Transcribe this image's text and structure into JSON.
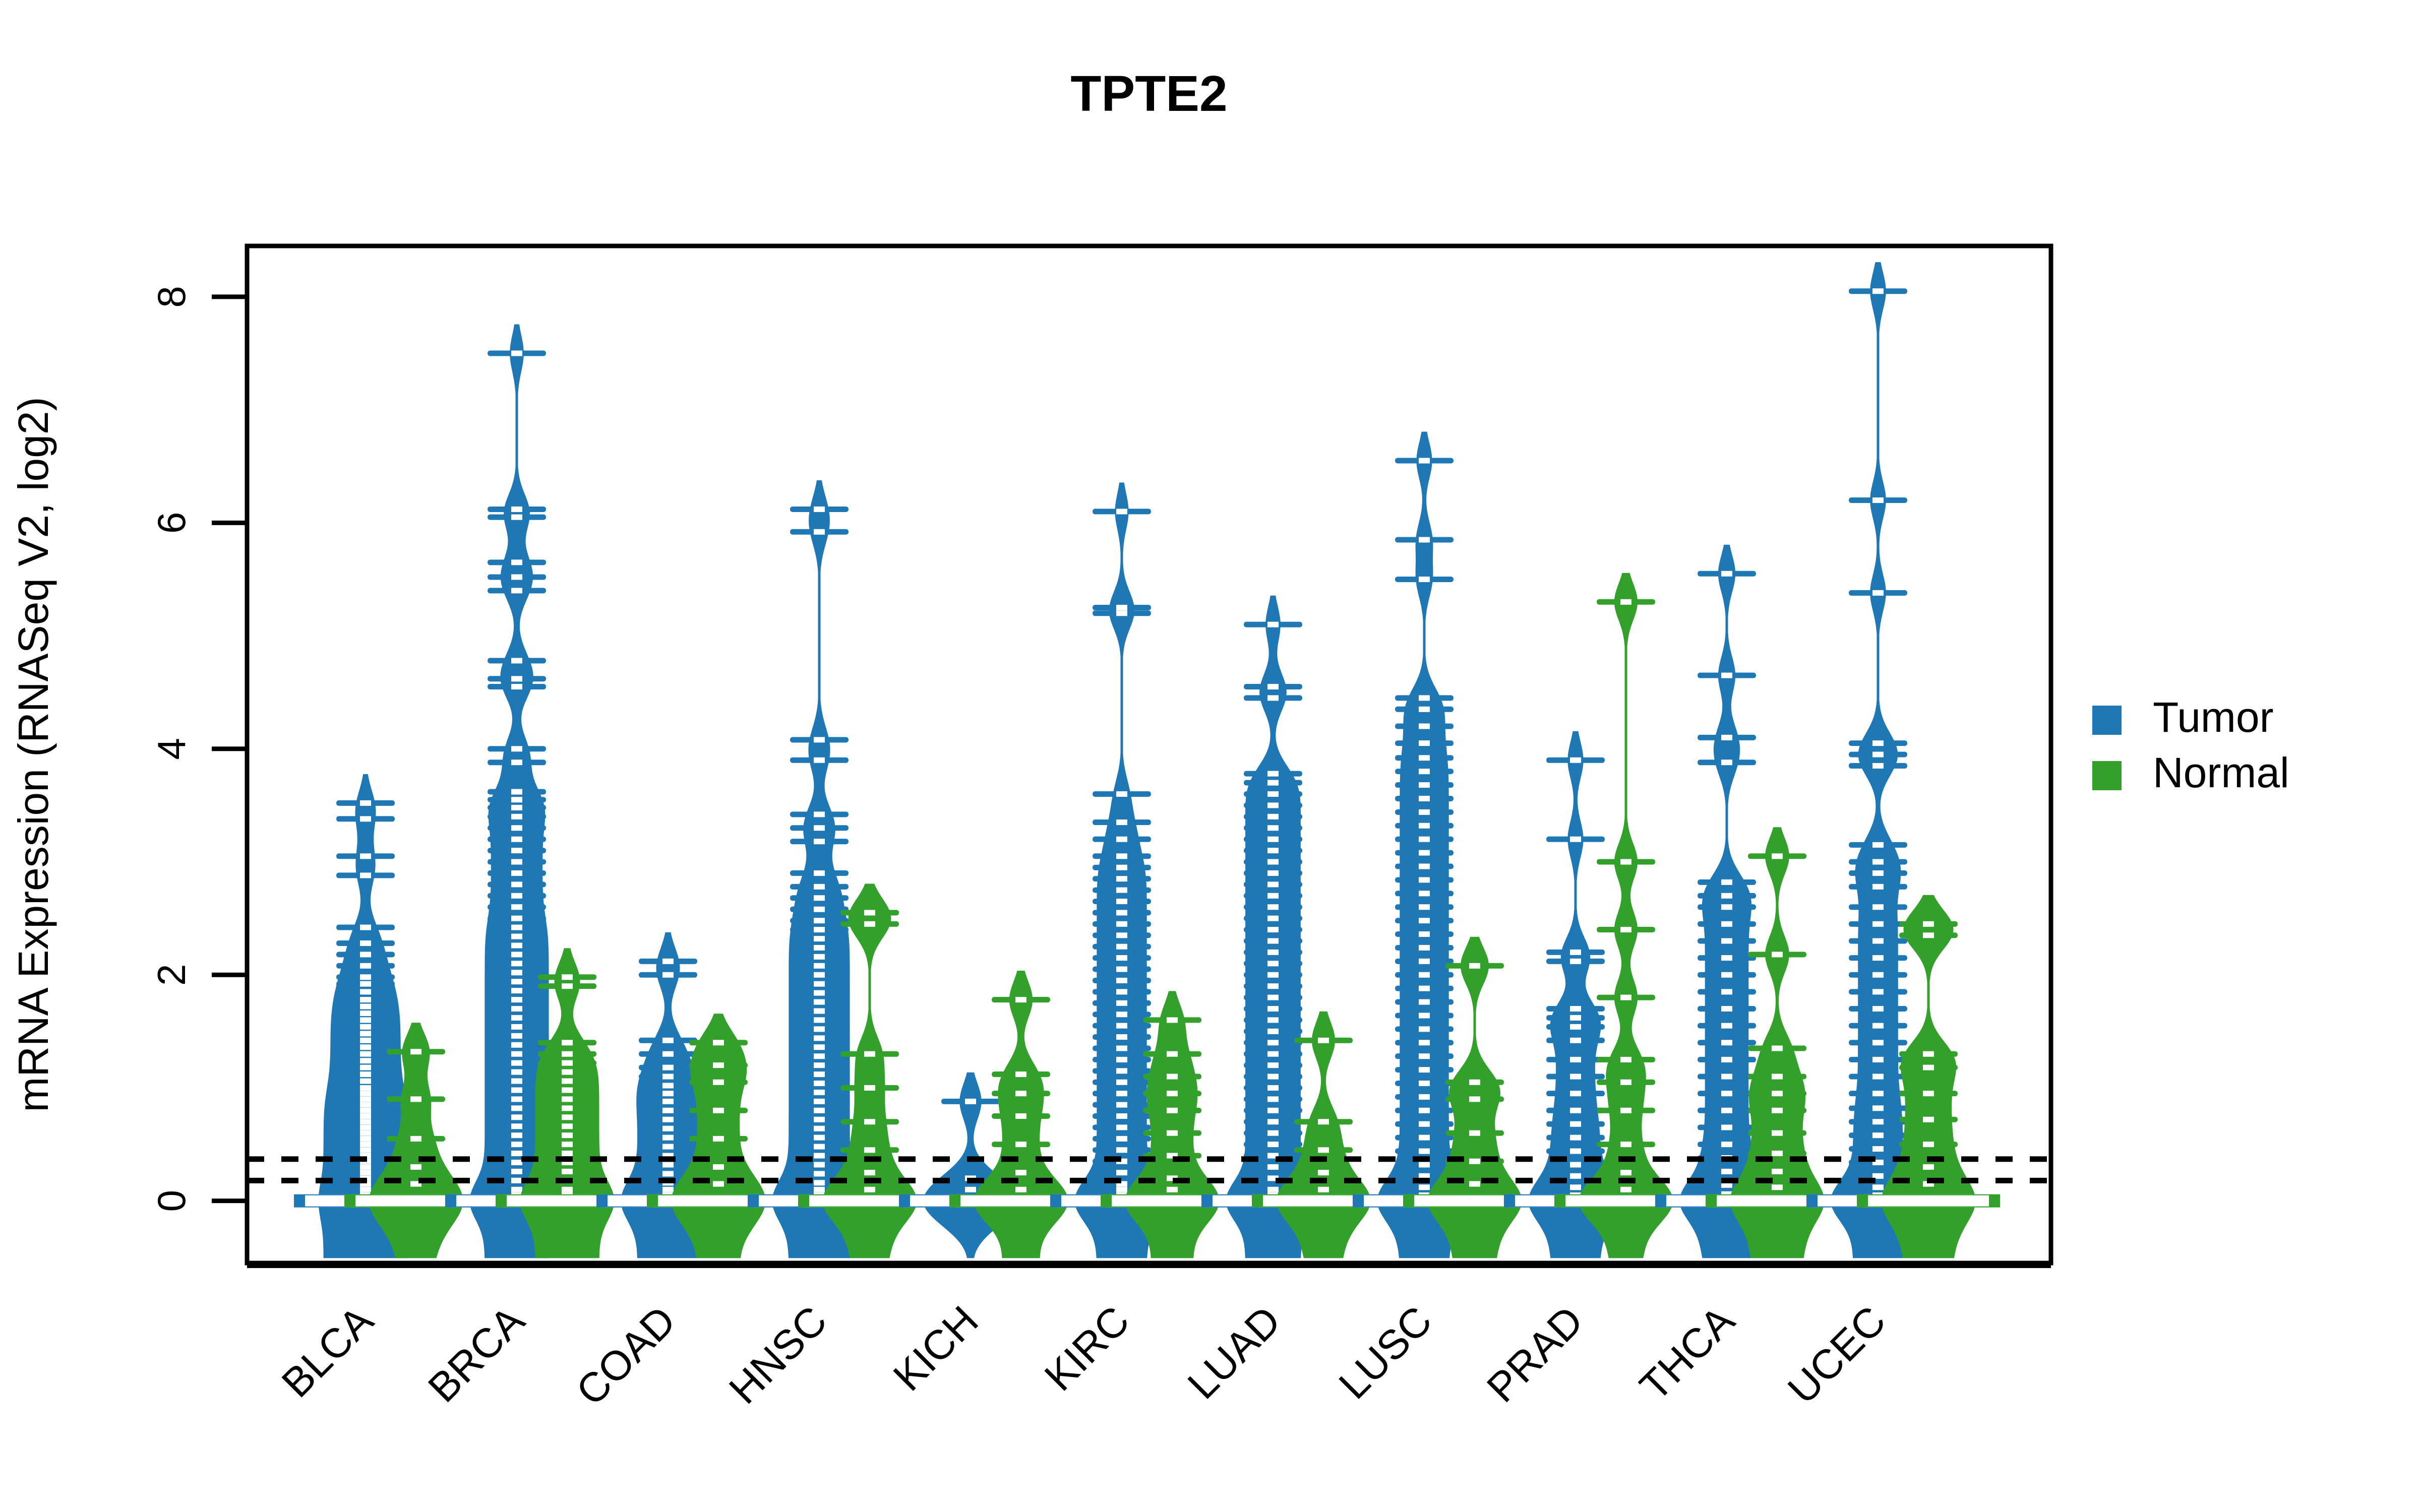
{
  "title": "TPTE2",
  "axes": {
    "ylabel": "mRNA Expression (RNASeq V2, log2)",
    "yticks": [
      "0",
      "2",
      "4",
      "6",
      "8"
    ],
    "ytickvalues": [
      0,
      2,
      4,
      6,
      8
    ],
    "ylim": [
      -0.55,
      8.45
    ],
    "xlabel": ""
  },
  "legend": {
    "position": "right",
    "items": [
      {
        "label": "Tumor",
        "color": "#1f78b4",
        "swatch": "legend-swatch-tumor"
      },
      {
        "label": "Normal",
        "color": "#33a02c",
        "swatch": "legend-swatch-normal"
      }
    ]
  },
  "reference_lines": {
    "values": [
      0.37,
      0.18
    ],
    "style": "dotted",
    "color": "#000000"
  },
  "chart_data": {
    "type": "violin",
    "variant": "beanplot",
    "title": "TPTE2",
    "xlabel": "",
    "ylabel": "mRNA Expression (RNASeq V2, log2)",
    "ylim": [
      -0.55,
      8.45
    ],
    "yticks": [
      0,
      2,
      4,
      6,
      8
    ],
    "grid": false,
    "legend_position": "right",
    "categories": [
      "BLCA",
      "BRCA",
      "COAD",
      "HNSC",
      "KICH",
      "KIRC",
      "LUAD",
      "LUSC",
      "PRAD",
      "THCA",
      "UCEC"
    ],
    "reference_lines": [
      0.37,
      0.18
    ],
    "series": [
      {
        "name": "Tumor",
        "color": "#1f78b4",
        "groups": [
          {
            "category": "BLCA",
            "median": 0.0,
            "max": 3.52,
            "min": 0.0,
            "density_peak": 0.0,
            "strip_values": [
              3.52,
              3.38,
              3.05,
              2.88,
              2.42,
              2.28,
              2.18,
              2.08,
              1.98,
              1.92,
              1.85,
              1.78,
              1.72,
              1.66,
              1.6,
              1.54,
              1.48,
              1.42,
              1.36,
              1.3,
              1.24,
              1.18,
              1.12,
              1.06,
              1.0,
              0.95,
              0.9,
              0.85,
              0.8,
              0.75,
              0.7,
              0.65,
              0.6,
              0.55,
              0.5,
              0.45,
              0.4,
              0.35,
              0.3,
              0.25,
              0.2,
              0.15,
              0.1,
              0.05,
              0.0
            ]
          },
          {
            "category": "BRCA",
            "median": 0.0,
            "max": 7.5,
            "min": 0.0,
            "density_peak": 0.0,
            "strip_values": [
              7.5,
              6.12,
              6.05,
              5.65,
              5.52,
              5.4,
              4.78,
              4.62,
              4.55,
              4.0,
              3.88,
              3.62,
              3.55,
              3.48,
              3.4,
              3.3,
              3.2,
              3.1,
              3.0,
              2.9,
              2.8,
              2.7,
              2.6,
              2.5,
              2.42,
              2.34,
              2.26,
              2.18,
              2.1,
              2.02,
              1.94,
              1.86,
              1.78,
              1.7,
              1.62,
              1.54,
              1.46,
              1.38,
              1.3,
              1.22,
              1.14,
              1.06,
              0.98,
              0.9,
              0.82,
              0.74,
              0.66,
              0.58,
              0.5,
              0.42,
              0.34,
              0.26,
              0.18,
              0.1,
              0.05,
              0.0
            ]
          },
          {
            "category": "COAD",
            "median": 0.0,
            "max": 2.12,
            "min": 0.0,
            "density_peak": 0.0,
            "strip_values": [
              2.12,
              2.0,
              1.42,
              1.3,
              1.18,
              1.1,
              1.02,
              0.95,
              0.88,
              0.8,
              0.72,
              0.64,
              0.56,
              0.48,
              0.4,
              0.32,
              0.24,
              0.16,
              0.1,
              0.05,
              0.0
            ]
          },
          {
            "category": "HNSC",
            "median": 0.0,
            "max": 6.12,
            "min": 0.0,
            "density_peak": 0.0,
            "strip_values": [
              6.12,
              5.92,
              4.08,
              3.9,
              3.42,
              3.3,
              3.18,
              2.9,
              2.78,
              2.68,
              2.58,
              2.48,
              2.4,
              2.32,
              2.24,
              2.16,
              2.08,
              2.0,
              1.92,
              1.84,
              1.76,
              1.68,
              1.6,
              1.52,
              1.44,
              1.36,
              1.28,
              1.2,
              1.12,
              1.04,
              0.96,
              0.88,
              0.8,
              0.72,
              0.64,
              0.56,
              0.48,
              0.4,
              0.32,
              0.24,
              0.16,
              0.1,
              0.05,
              0.0
            ]
          },
          {
            "category": "KICH",
            "median": 0.0,
            "max": 0.88,
            "min": 0.0,
            "density_peak": 0.0,
            "strip_values": [
              0.88,
              0.2,
              0.1,
              0.0
            ]
          },
          {
            "category": "KIRC",
            "median": 0.0,
            "max": 6.1,
            "min": 0.0,
            "density_peak": 0.0,
            "strip_values": [
              6.1,
              5.25,
              5.2,
              3.6,
              3.35,
              3.2,
              3.05,
              2.95,
              2.85,
              2.75,
              2.65,
              2.55,
              2.45,
              2.35,
              2.25,
              2.15,
              2.05,
              1.95,
              1.85,
              1.75,
              1.65,
              1.55,
              1.45,
              1.35,
              1.25,
              1.15,
              1.05,
              0.95,
              0.85,
              0.75,
              0.65,
              0.55,
              0.45,
              0.35,
              0.25,
              0.15,
              0.1,
              0.05,
              0.0
            ]
          },
          {
            "category": "LUAD",
            "median": 0.0,
            "max": 5.1,
            "min": 0.0,
            "density_peak": 0.0,
            "strip_values": [
              5.1,
              4.55,
              4.45,
              3.78,
              3.7,
              3.6,
              3.5,
              3.4,
              3.3,
              3.2,
              3.1,
              3.0,
              2.9,
              2.8,
              2.7,
              2.6,
              2.5,
              2.4,
              2.3,
              2.2,
              2.1,
              2.0,
              1.9,
              1.8,
              1.7,
              1.6,
              1.5,
              1.4,
              1.3,
              1.2,
              1.1,
              1.0,
              0.9,
              0.8,
              0.7,
              0.6,
              0.5,
              0.4,
              0.3,
              0.2,
              0.1,
              0.05,
              0.0
            ]
          },
          {
            "category": "LUSC",
            "median": 0.0,
            "max": 6.55,
            "min": 0.0,
            "density_peak": 0.0,
            "strip_values": [
              6.55,
              5.85,
              5.5,
              4.45,
              4.35,
              4.2,
              4.05,
              3.92,
              3.8,
              3.68,
              3.56,
              3.44,
              3.32,
              3.2,
              3.08,
              2.96,
              2.84,
              2.72,
              2.6,
              2.48,
              2.36,
              2.24,
              2.12,
              2.0,
              1.88,
              1.76,
              1.64,
              1.52,
              1.4,
              1.28,
              1.16,
              1.04,
              0.92,
              0.8,
              0.68,
              0.56,
              0.44,
              0.32,
              0.22,
              0.12,
              0.05,
              0.0
            ]
          },
          {
            "category": "PRAD",
            "median": 0.0,
            "max": 3.9,
            "min": 0.0,
            "density_peak": 0.0,
            "strip_values": [
              3.9,
              3.2,
              2.2,
              2.12,
              1.7,
              1.62,
              1.54,
              1.42,
              1.25,
              1.1,
              0.95,
              0.8,
              0.68,
              0.56,
              0.44,
              0.32,
              0.22,
              0.12,
              0.05,
              0.0
            ]
          },
          {
            "category": "THCA",
            "median": 0.0,
            "max": 5.55,
            "min": 0.0,
            "density_peak": 0.0,
            "strip_values": [
              5.55,
              4.65,
              4.1,
              3.88,
              2.82,
              2.7,
              2.6,
              2.45,
              2.3,
              2.15,
              2.0,
              1.85,
              1.7,
              1.55,
              1.4,
              1.25,
              1.1,
              0.95,
              0.8,
              0.65,
              0.5,
              0.38,
              0.26,
              0.14,
              0.06,
              0.0
            ]
          },
          {
            "category": "UCEC",
            "median": 0.0,
            "max": 8.05,
            "min": 0.0,
            "density_peak": 0.0,
            "strip_values": [
              8.05,
              6.2,
              5.38,
              4.05,
              3.95,
              3.85,
              3.15,
              3.0,
              2.9,
              2.78,
              2.6,
              2.45,
              2.3,
              2.15,
              2.0,
              1.85,
              1.7,
              1.55,
              1.4,
              1.25,
              1.1,
              0.95,
              0.82,
              0.7,
              0.58,
              0.46,
              0.34,
              0.22,
              0.12,
              0.05,
              0.0
            ]
          }
        ]
      },
      {
        "name": "Normal",
        "color": "#33a02c",
        "groups": [
          {
            "category": "BLCA",
            "median": 0.0,
            "max": 1.32,
            "min": 0.0,
            "density_peak": 0.0,
            "strip_values": [
              1.32,
              0.9,
              0.55,
              0.3,
              0.15,
              0.0
            ]
          },
          {
            "category": "BRCA",
            "median": 0.0,
            "max": 1.98,
            "min": 0.0,
            "density_peak": 0.0,
            "strip_values": [
              1.98,
              1.9,
              1.4,
              1.3,
              1.22,
              1.14,
              1.06,
              0.98,
              0.9,
              0.82,
              0.74,
              0.66,
              0.58,
              0.5,
              0.42,
              0.34,
              0.26,
              0.18,
              0.1,
              0.05,
              0.0
            ]
          },
          {
            "category": "COAD",
            "median": 0.0,
            "max": 1.4,
            "min": 0.0,
            "density_peak": 0.0,
            "strip_values": [
              1.4,
              1.2,
              1.05,
              0.8,
              0.55,
              0.3,
              0.15,
              0.0
            ]
          },
          {
            "category": "HNSC",
            "median": 0.0,
            "max": 2.55,
            "min": 0.0,
            "density_peak": 0.0,
            "strip_values": [
              2.55,
              2.45,
              1.3,
              1.0,
              0.7,
              0.45,
              0.25,
              0.1,
              0.0
            ]
          },
          {
            "category": "KICH",
            "median": 0.0,
            "max": 1.78,
            "min": 0.0,
            "density_peak": 0.0,
            "strip_values": [
              1.78,
              1.12,
              0.95,
              0.75,
              0.5,
              0.25,
              0.1,
              0.0
            ]
          },
          {
            "category": "KIRC",
            "median": 0.0,
            "max": 1.6,
            "min": 0.0,
            "density_peak": 0.0,
            "strip_values": [
              1.6,
              1.3,
              1.1,
              0.95,
              0.8,
              0.6,
              0.4,
              0.2,
              0.1,
              0.0
            ]
          },
          {
            "category": "LUAD",
            "median": 0.0,
            "max": 1.42,
            "min": 0.0,
            "density_peak": 0.0,
            "strip_values": [
              1.42,
              0.7,
              0.45,
              0.25,
              0.1,
              0.0
            ]
          },
          {
            "category": "LUSC",
            "median": 0.0,
            "max": 2.08,
            "min": 0.0,
            "density_peak": 0.0,
            "strip_values": [
              2.08,
              1.05,
              0.9,
              0.6,
              0.35,
              0.15,
              0.0
            ]
          },
          {
            "category": "PRAD",
            "median": 0.0,
            "max": 5.3,
            "min": 0.0,
            "density_peak": 0.0,
            "strip_values": [
              5.3,
              3.0,
              2.4,
              1.8,
              1.25,
              1.05,
              0.8,
              0.5,
              0.25,
              0.1,
              0.0
            ]
          },
          {
            "category": "THCA",
            "median": 0.0,
            "max": 3.05,
            "min": 0.0,
            "density_peak": 0.0,
            "strip_values": [
              3.05,
              2.18,
              1.35,
              1.1,
              0.95,
              0.8,
              0.6,
              0.42,
              0.26,
              0.12,
              0.0
            ]
          },
          {
            "category": "UCEC",
            "median": 0.0,
            "max": 2.45,
            "min": 0.0,
            "density_peak": 0.0,
            "strip_values": [
              2.45,
              2.35,
              1.3,
              1.18,
              0.95,
              0.72,
              0.5,
              0.3,
              0.15,
              0.0
            ]
          }
        ]
      }
    ]
  },
  "geometry": {
    "plot_left": 490,
    "plot_right": 4068,
    "plot_top": 488,
    "plot_bottom": 2506,
    "group_spacing": 300,
    "first_group_center": 775,
    "series_offset": 50
  }
}
